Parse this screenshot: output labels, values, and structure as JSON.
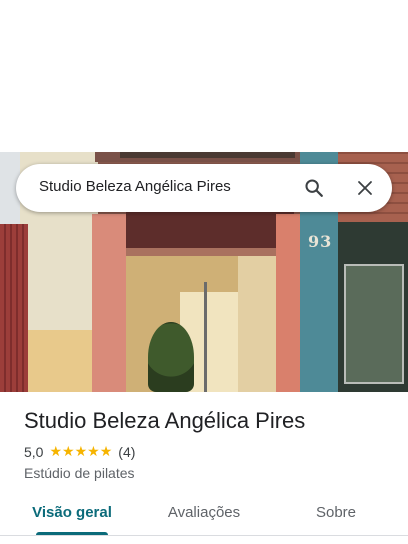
{
  "search": {
    "query": "Studio Beleza Angélica Pires",
    "search_icon": "search-icon",
    "close_icon": "close-icon"
  },
  "hero": {
    "street_number": "93"
  },
  "place": {
    "name": "Studio Beleza Angélica Pires",
    "rating": "5,0",
    "stars": 5,
    "reviews": "(4)",
    "category": "Estúdio de pilates"
  },
  "tabs": [
    {
      "label": "Visão geral",
      "active": true
    },
    {
      "label": "Avaliações",
      "active": false
    },
    {
      "label": "Sobre",
      "active": false
    }
  ],
  "colors": {
    "accent": "#0b6b7a",
    "star": "#f6b400",
    "text_primary": "#202124",
    "text_secondary": "#5f6368"
  }
}
